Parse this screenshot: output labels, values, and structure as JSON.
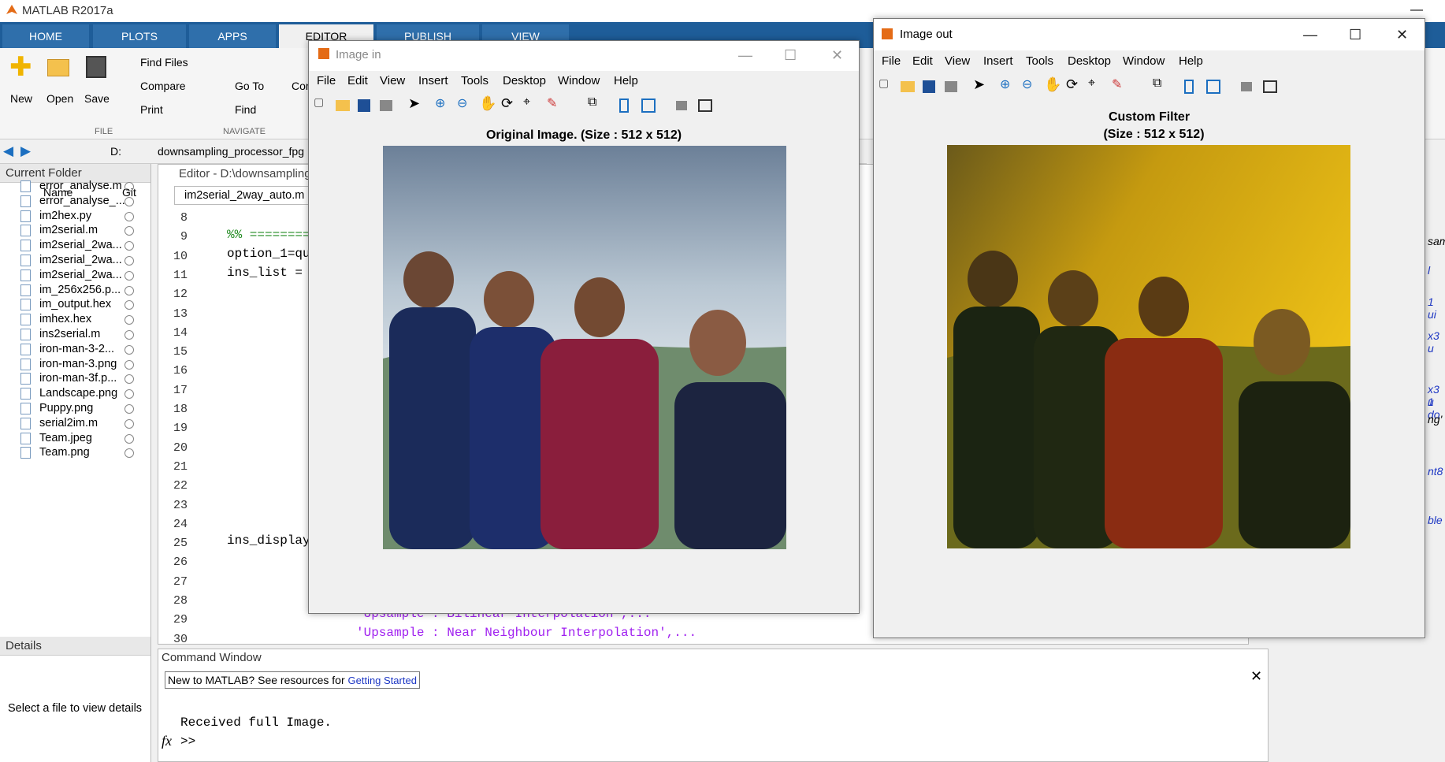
{
  "app": {
    "title": "MATLAB R2017a"
  },
  "tabs": [
    {
      "label": "HOME"
    },
    {
      "label": "PLOTS"
    },
    {
      "label": "APPS"
    },
    {
      "label": "EDITOR"
    },
    {
      "label": "PUBLISH"
    },
    {
      "label": "VIEW"
    }
  ],
  "ribbon": {
    "new": "New",
    "open": "Open",
    "save": "Save",
    "find_files": "Find Files",
    "compare": "Compare",
    "print": "Print",
    "go_to": "Go To",
    "find": "Find",
    "comment": "Con",
    "group_file": "FILE",
    "group_navigate": "NAVIGATE"
  },
  "address": {
    "drive": "D:",
    "path": "downsampling_processor_fpg"
  },
  "current_folder": {
    "title": "Current Folder",
    "col_name": "Name",
    "col_git": "Git",
    "files": [
      "error_analyse.m",
      "error_analyse_...",
      "im2hex.py",
      "im2serial.m",
      "im2serial_2wa...",
      "im2serial_2wa...",
      "im2serial_2wa...",
      "im_256x256.p...",
      "im_output.hex",
      "imhex.hex",
      "ins2serial.m",
      "iron-man-3-2...",
      "iron-man-3.png",
      "iron-man-3f.p...",
      "Landscape.png",
      "Puppy.png",
      "serial2im.m",
      "Team.jpeg",
      "Team.png"
    ]
  },
  "details": {
    "title": "Details",
    "hint": "Select a file to view details"
  },
  "editor": {
    "title": "Editor - D:\\downsampling",
    "file_tab": "im2serial_2way_auto.m",
    "line_numbers": [
      "8",
      "9",
      "10",
      "11",
      "12",
      "13",
      "14",
      "15",
      "16",
      "17",
      "18",
      "19",
      "20",
      "21",
      "22",
      "23",
      "24",
      "25",
      "26",
      "27",
      "28",
      "29",
      "30"
    ],
    "line9": "%% ========",
    "line10": "option_1=qu",
    "line11": "ins_list =",
    "line25": "ins_display",
    "line29": "'Upsample : Bilinear Interpolation',...",
    "line30": "'Upsample : Near Neighbour Interpolation',...",
    "side_fragments": [
      "sam",
      "l",
      "1 ui",
      "x3 u",
      "x3 u",
      "1 do",
      "ng'",
      "nt8",
      "ble"
    ]
  },
  "command_window": {
    "title": "Command Window",
    "banner": "New to MATLAB? See resources for",
    "banner_link": "Getting Started",
    "output": "Received full Image.",
    "prompt": ">>",
    "fx": "fx"
  },
  "figure_in": {
    "title": "Image in",
    "menu": [
      "File",
      "Edit",
      "View",
      "Insert",
      "Tools",
      "Desktop",
      "Window",
      "Help"
    ],
    "caption": "Original Image.  (Size : 512 x 512)"
  },
  "figure_out": {
    "title": "Image out",
    "menu": [
      "File",
      "Edit",
      "View",
      "Insert",
      "Tools",
      "Desktop",
      "Window",
      "Help"
    ],
    "caption_line1": "Custom Filter",
    "caption_line2": "(Size : 512 x 512)"
  },
  "colors": {
    "tabbar": "#1e5d99",
    "comment_green": "#228b22",
    "string_purple": "#a020f0"
  }
}
